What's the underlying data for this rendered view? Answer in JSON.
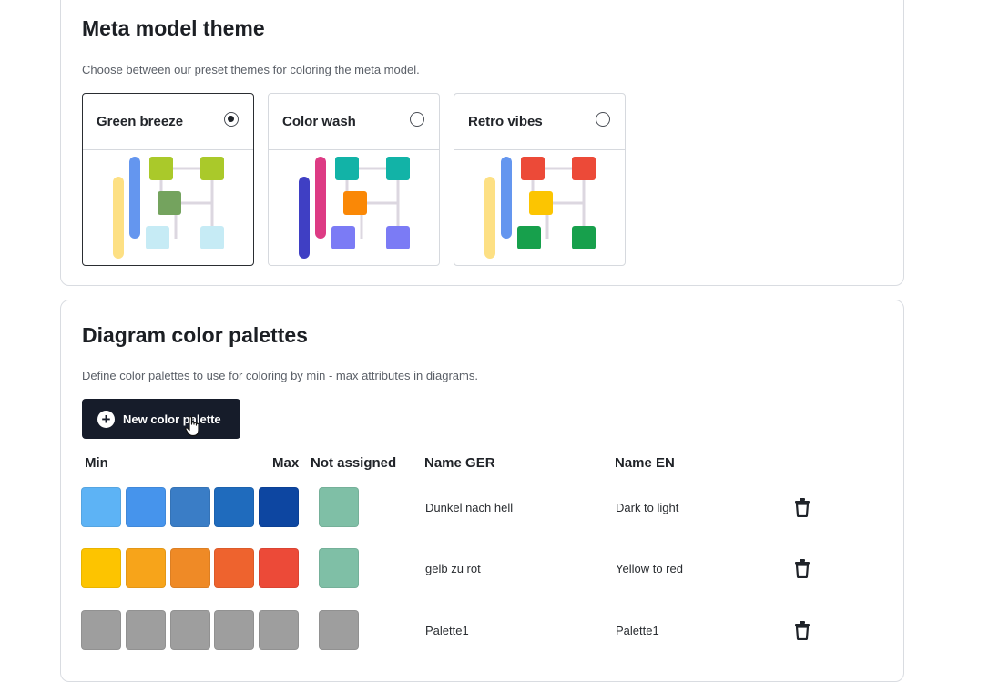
{
  "theme_section": {
    "title": "Meta model theme",
    "description": "Choose between our preset themes for coloring the meta model.",
    "options": [
      {
        "label": "Green breeze",
        "selected": true,
        "colors": {
          "bar_back": "#fde084",
          "bar_front": "#6496ef",
          "top": "#aac92a",
          "middle": "#74a35e",
          "bottom": "#c6ebf5"
        }
      },
      {
        "label": "Color wash",
        "selected": false,
        "colors": {
          "bar_back": "#3f3fc4",
          "bar_front": "#dd3b84",
          "top": "#12b3a7",
          "middle": "#fa8806",
          "bottom": "#7b7bf5"
        }
      },
      {
        "label": "Retro vibes",
        "selected": false,
        "colors": {
          "bar_back": "#fde084",
          "bar_front": "#6496ef",
          "top": "#ec4a38",
          "middle": "#fcc501",
          "bottom": "#17a04c"
        }
      }
    ]
  },
  "palette_section": {
    "title": "Diagram color palettes",
    "description": "Define color palettes to use for coloring by min - max attributes in diagrams.",
    "new_button_label": "New color palette",
    "columns": {
      "min": "Min",
      "max": "Max",
      "not_assigned": "Not assigned",
      "name_ger": "Name GER",
      "name_en": "Name EN"
    },
    "palettes": [
      {
        "colors": [
          "#5db3f5",
          "#4694ec",
          "#3a7dc6",
          "#1f6bbd",
          "#0d46a1"
        ],
        "not_assigned": "#7fbfa6",
        "name_ger": "Dunkel nach hell",
        "name_en": "Dark to light"
      },
      {
        "colors": [
          "#fdc400",
          "#f7a41a",
          "#ef8a26",
          "#ee632e",
          "#ec4a38"
        ],
        "not_assigned": "#7fbfa6",
        "name_ger": "gelb zu rot",
        "name_en": "Yellow to red"
      },
      {
        "colors": [
          "#9e9e9e",
          "#9e9e9e",
          "#9e9e9e",
          "#9e9e9e",
          "#9e9e9e"
        ],
        "not_assigned": "#9e9e9e",
        "name_ger": "Palette1",
        "name_en": "Palette1"
      }
    ]
  }
}
